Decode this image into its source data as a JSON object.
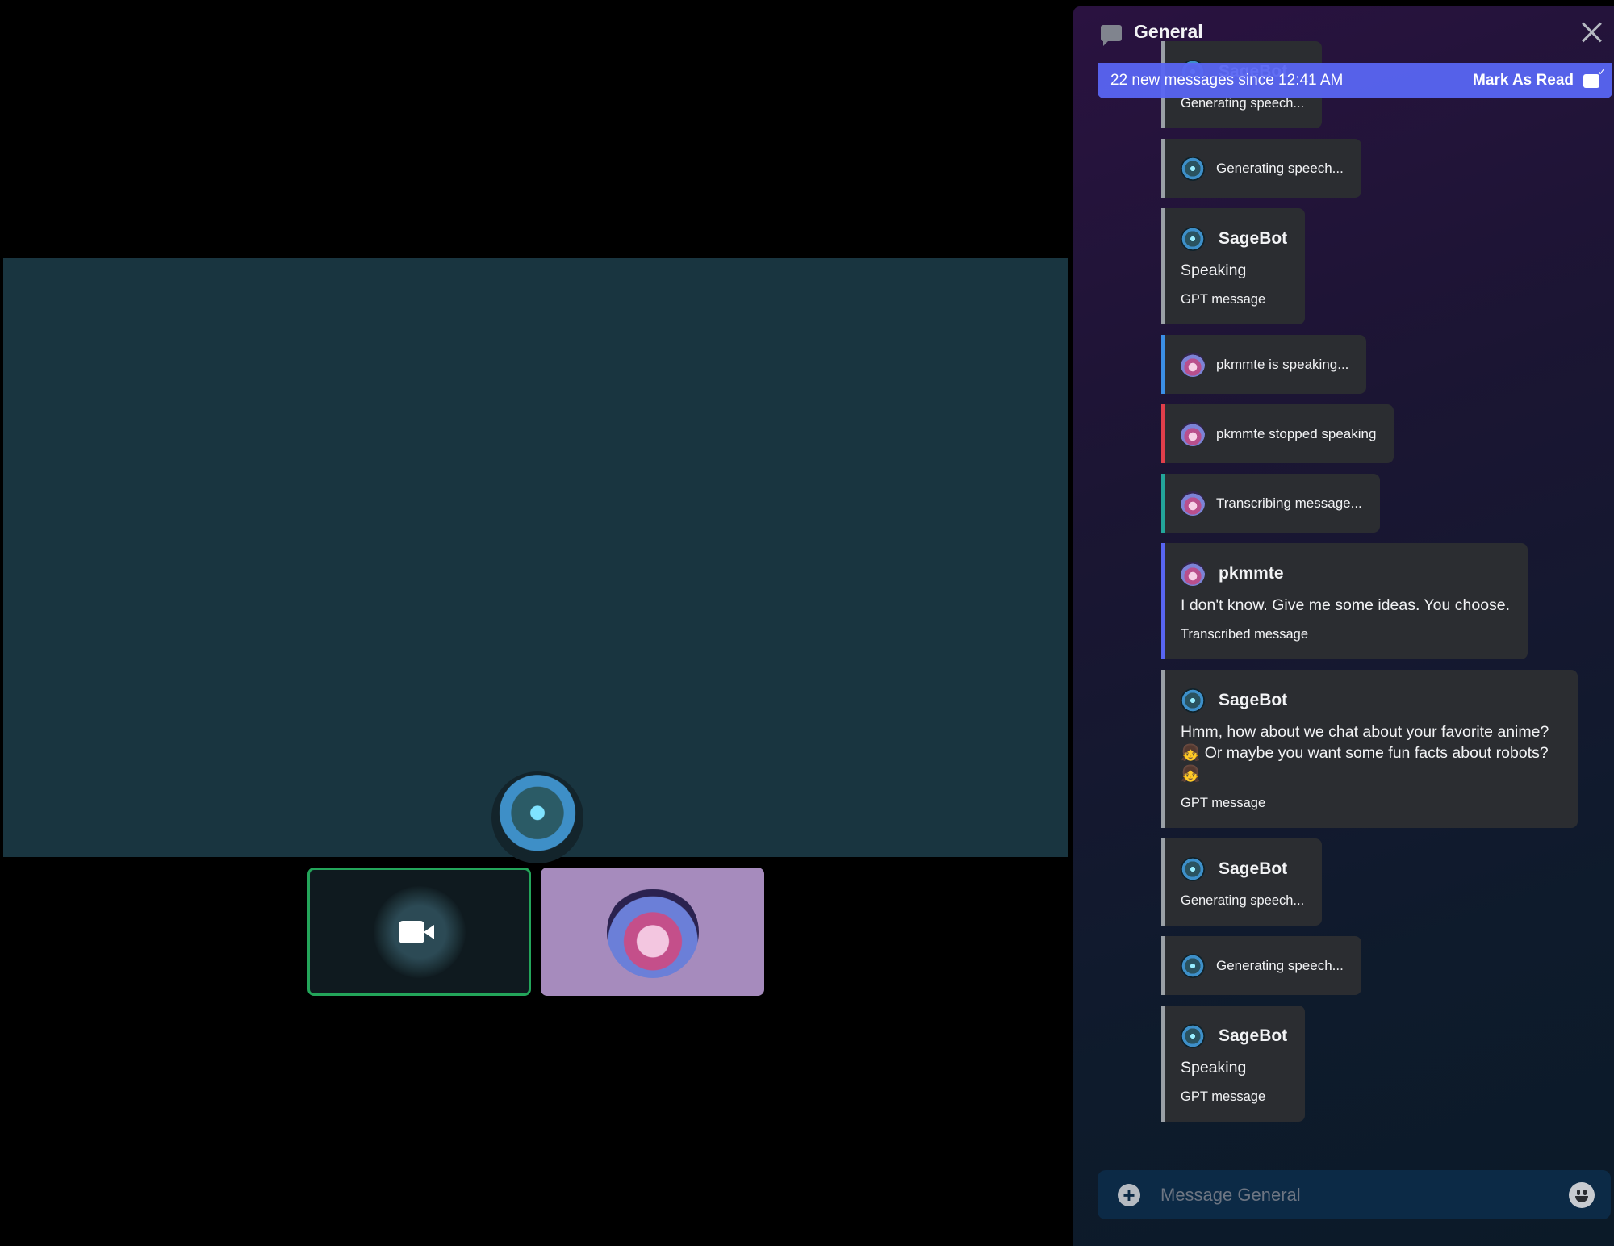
{
  "channel": {
    "title": "General",
    "icon": "chat-bubble-icon"
  },
  "banner": {
    "text": "22 new messages since 12:41 AM",
    "action": "Mark As Read"
  },
  "composer": {
    "placeholder": "Message General"
  },
  "colors": {
    "accent": "#5865f2",
    "speaking": "#3b8fe6",
    "stopped": "#e03e4a",
    "transcribing": "#23a59a",
    "message": "#5865f2",
    "bot": "#9aa0a6",
    "video_active": "#23a55a",
    "main_video_bg": "#193540",
    "user_tile_bg": "#a68bbd"
  },
  "messages": [
    {
      "kind": "full",
      "avatar": "bot",
      "name": "SageBot",
      "body": "",
      "footer": "Generating speech...",
      "border": "bot"
    },
    {
      "kind": "status",
      "avatar": "bot",
      "text": "Generating speech...",
      "border": "bot"
    },
    {
      "kind": "full",
      "avatar": "bot",
      "name": "SageBot",
      "body": "Speaking",
      "footer": "GPT message",
      "border": "bot"
    },
    {
      "kind": "status",
      "avatar": "user",
      "text": "pkmmte is speaking...",
      "border": "speaking"
    },
    {
      "kind": "status",
      "avatar": "user",
      "text": "pkmmte stopped speaking",
      "border": "stopped"
    },
    {
      "kind": "status",
      "avatar": "user",
      "text": "Transcribing message...",
      "border": "transcribing"
    },
    {
      "kind": "full",
      "avatar": "user",
      "name": "pkmmte",
      "body": "I don't know. Give me some ideas. You choose.",
      "footer": "Transcribed message",
      "border": "message"
    },
    {
      "kind": "full",
      "avatar": "bot",
      "name": "SageBot",
      "body": "Hmm, how about we chat about your favorite anime? 👧 Or maybe you want some fun facts about robots? 👧",
      "footer": "GPT message",
      "border": "bot"
    },
    {
      "kind": "full",
      "avatar": "bot",
      "name": "SageBot",
      "body": "",
      "footer": "Generating speech...",
      "border": "bot"
    },
    {
      "kind": "status",
      "avatar": "bot",
      "text": "Generating speech...",
      "border": "bot"
    },
    {
      "kind": "full",
      "avatar": "bot",
      "name": "SageBot",
      "body": "Speaking",
      "footer": "GPT message",
      "border": "bot"
    }
  ]
}
